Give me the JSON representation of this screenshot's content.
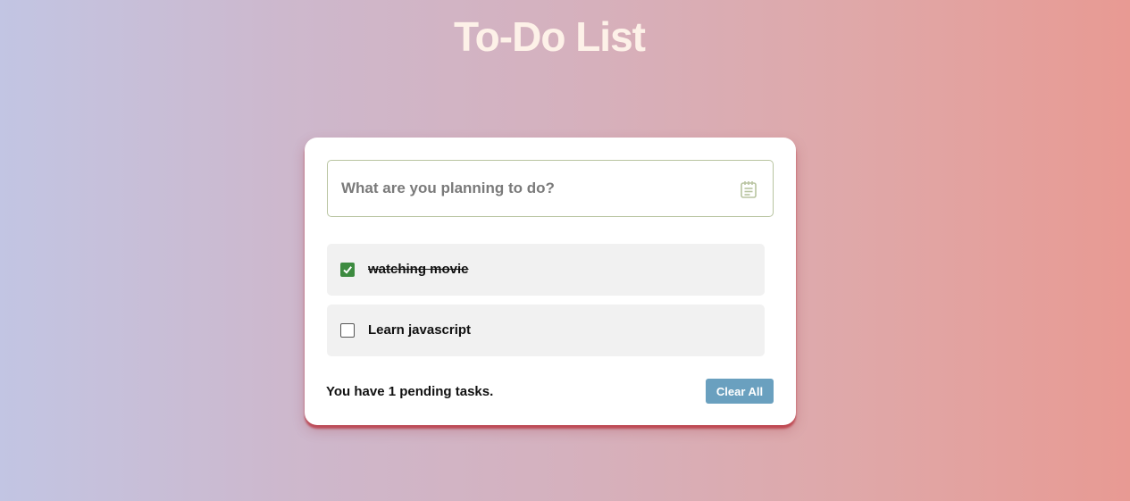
{
  "header": {
    "title": "To-Do List"
  },
  "input": {
    "placeholder": "What are you planning to do?",
    "icon": "notepad-icon",
    "border_color": "#b8c4a0"
  },
  "tasks": [
    {
      "label": "watching movie",
      "completed": true
    },
    {
      "label": "Learn javascript",
      "completed": false
    }
  ],
  "footer": {
    "status_prefix": "You have ",
    "pending_count": "1",
    "status_suffix": " pending tasks.",
    "clear_label": "Clear All"
  },
  "colors": {
    "title": "#fdf1e8",
    "checkbox_checked": "#3d8b40",
    "clear_button": "#6aa0bf",
    "card_shadow": "#b9323c"
  }
}
